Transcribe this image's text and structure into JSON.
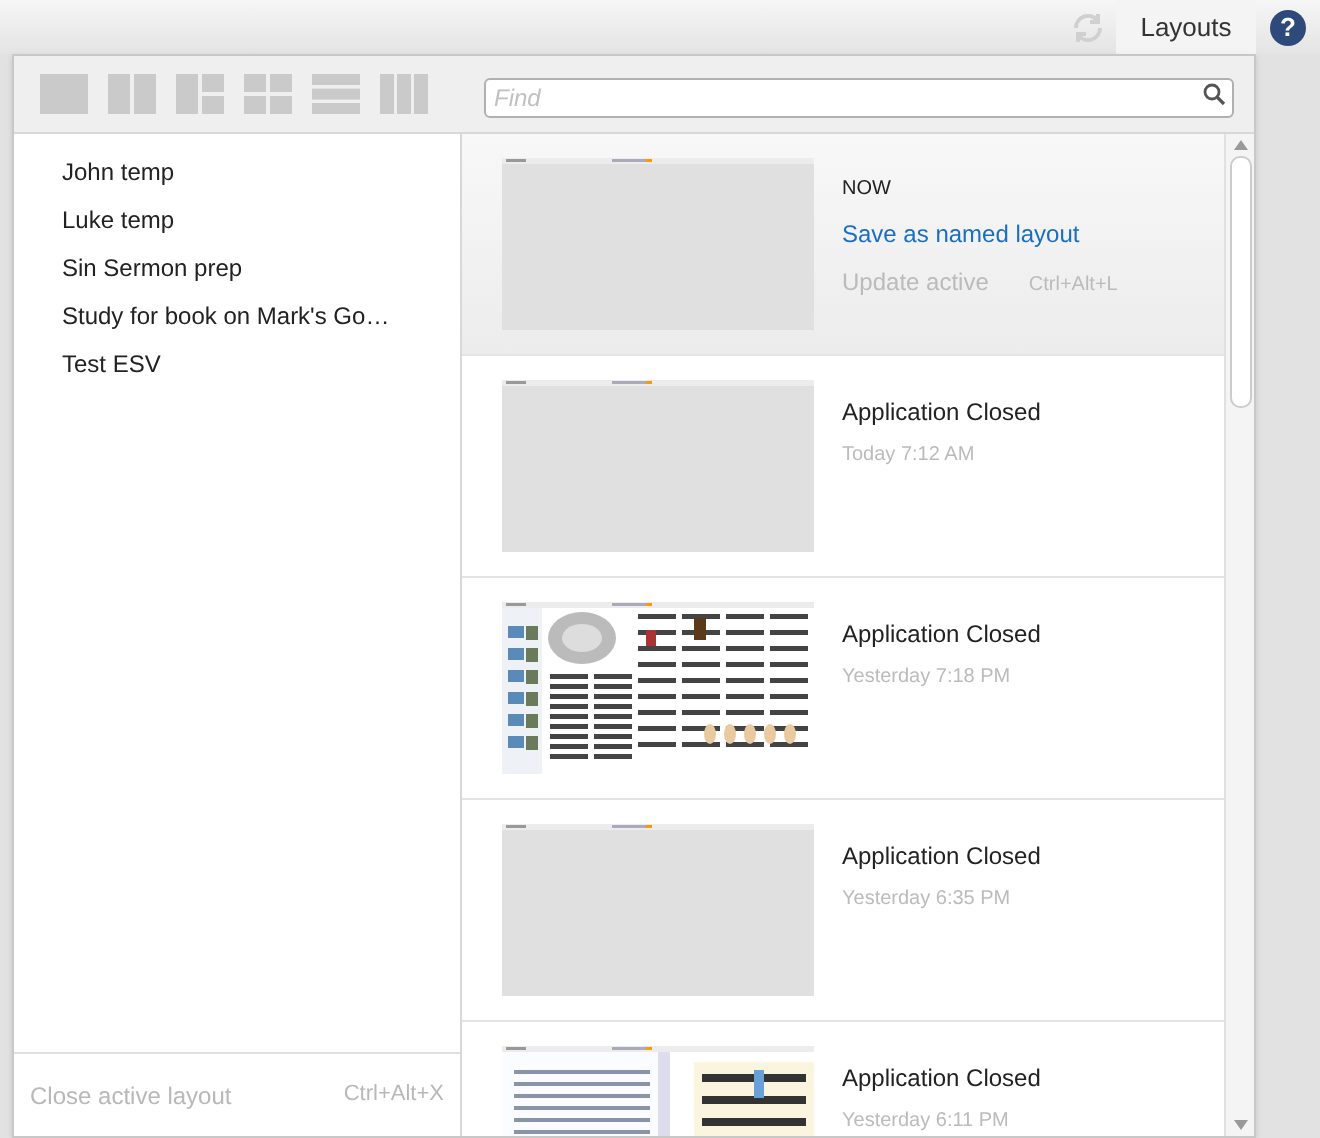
{
  "top_bar": {
    "tab": "Layouts",
    "help": "?"
  },
  "layout_modes": [
    {
      "kind": "single"
    },
    {
      "kind": "two-columns"
    },
    {
      "kind": "left-plus-two"
    },
    {
      "kind": "grid"
    },
    {
      "kind": "rows"
    },
    {
      "kind": "three-columns"
    }
  ],
  "search": {
    "placeholder": "Find"
  },
  "named_layouts": [
    "John temp",
    "Luke temp",
    "Sin Sermon prep",
    "Study for book on Mark's Go…",
    "Test ESV"
  ],
  "close_action": {
    "label": "Close active layout",
    "shortcut": "Ctrl+Alt+X"
  },
  "current": {
    "heading": "NOW",
    "save_link": "Save as named layout",
    "update": {
      "label": "Update active",
      "shortcut": "Ctrl+Alt+L",
      "disabled": true
    },
    "kind": "blank",
    "selected": true
  },
  "history": [
    {
      "title": "Application Closed",
      "time": "Today 7:12 AM",
      "kind": "blank",
      "selected": false
    },
    {
      "title": "Application Closed",
      "time": "Yesterday 7:18 PM",
      "kind": "article",
      "selected": false
    },
    {
      "title": "Application Closed",
      "time": "Yesterday 6:35 PM",
      "kind": "blank",
      "selected": false
    },
    {
      "title": "Application Closed",
      "time": "Yesterday 6:11 PM",
      "kind": "split",
      "selected": false
    }
  ]
}
